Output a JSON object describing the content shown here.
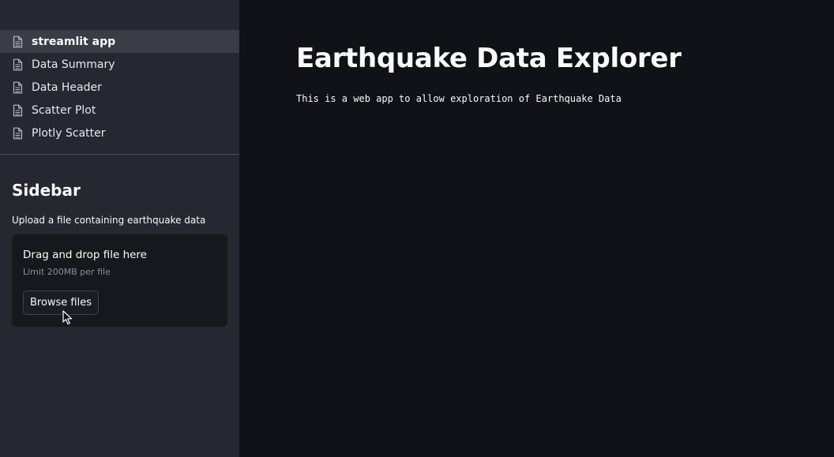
{
  "sidebar": {
    "nav": [
      {
        "label": "streamlit app",
        "icon": "document-icon",
        "active": true
      },
      {
        "label": "Data Summary",
        "icon": "document-icon",
        "active": false
      },
      {
        "label": "Data Header",
        "icon": "document-icon",
        "active": false
      },
      {
        "label": "Scatter Plot",
        "icon": "document-icon",
        "active": false
      },
      {
        "label": "Plotly Scatter",
        "icon": "document-icon",
        "active": false
      }
    ],
    "title": "Sidebar",
    "upload_label": "Upload a file containing earthquake data",
    "dropzone": {
      "title": "Drag and drop file here",
      "limit": "Limit 200MB per file",
      "button_label": "Browse files"
    }
  },
  "main": {
    "title": "Earthquake Data Explorer",
    "description": "This is a web app to allow exploration of Earthquake Data"
  },
  "colors": {
    "background": "#0e1117",
    "sidebar": "#262730",
    "active_nav": "#3b3c45",
    "text": "#fafafa"
  }
}
